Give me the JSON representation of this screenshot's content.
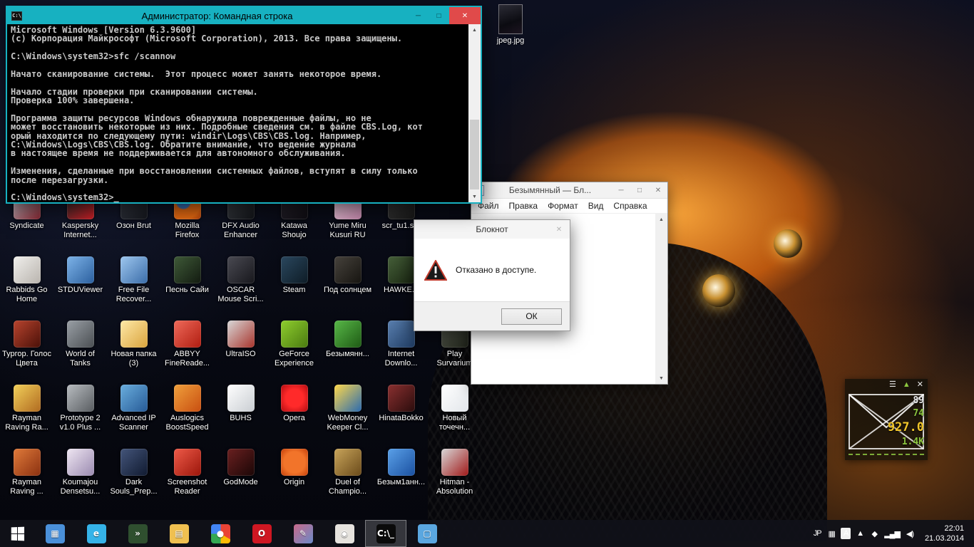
{
  "ui": {
    "scroll_up": "▲",
    "scroll_down": "▼",
    "min_glyph": "─",
    "max_glyph": "□",
    "close_glyph": "✕"
  },
  "cmd_window": {
    "accent": "#17b1c1",
    "icon_text": "C:\\",
    "title": "Администратор: Командная строка",
    "lines": [
      "Microsoft Windows [Version 6.3.9600]",
      "(c) Корпорация Майкрософт (Microsoft Corporation), 2013. Все права защищены.",
      "",
      "C:\\Windows\\system32>sfc /scannow",
      "",
      "Начато сканирование системы.  Этот процесс может занять некоторое время.",
      "",
      "Начало стадии проверки при сканировании системы.",
      "Проверка 100% завершена.",
      "",
      "Программа защиты ресурсов Windows обнаружила поврежденные файлы, но не",
      "может восстановить некоторые из них. Подробные сведения см. в файле CBS.Log, кот",
      "орый находится по следующему пути: windir\\Logs\\CBS\\CBS.log. Например,",
      "C:\\Windows\\Logs\\CBS\\CBS.log. Обратите внимание, что ведение журнала",
      "в настоящее время не поддерживается для автономного обслуживания.",
      "",
      "Изменения, сделанные при восстановлении системных файлов, вступят в силу только",
      "после перезагрузки.",
      "",
      "C:\\Windows\\system32>_"
    ]
  },
  "notepad": {
    "title": "Безымянный — Бл...",
    "menu": [
      {
        "label": "Файл"
      },
      {
        "label": "Правка"
      },
      {
        "label": "Формат"
      },
      {
        "label": "Вид"
      },
      {
        "label": "Справка"
      }
    ]
  },
  "dialog": {
    "title": "Блокнот",
    "message": "Отказано в доступе.",
    "ok": "ОК"
  },
  "desktop": {
    "jpeg_label": "jpeg.jpg",
    "row1": [
      {
        "label": "Syndicate",
        "color": "linear-gradient(135deg,#caced6,#8a2430)"
      },
      {
        "label": "Kaspersky Internet...",
        "color": "linear-gradient(135deg,#2b2b2b,#d21f26)"
      },
      {
        "label": "Озон Brut",
        "color": "linear-gradient(135deg,#3a3f4a,#14161c)"
      },
      {
        "label": "Mozilla Firefox",
        "color": "radial-gradient(circle at 35% 35%,#3b6fb5 0 26%,#e66a12 32% 70%,#b33c06 100%)"
      },
      {
        "label": "DFX Audio Enhancer",
        "color": "linear-gradient(135deg,#44484e,#101216)"
      },
      {
        "label": "Katawa Shoujo",
        "color": "linear-gradient(135deg,#2a2630,#0e0c12)"
      },
      {
        "label": "Yume Miru Kusuri RU",
        "color": "linear-gradient(135deg,#f3d7e6,#c687ad)"
      },
      {
        "label": "scr_tu1.s...",
        "color": "linear-gradient(135deg,#3c3c3c,#181818)"
      }
    ],
    "row2": [
      {
        "label": "Rabbids Go Home",
        "color": "linear-gradient(135deg,#f0efec,#b9b4ae)"
      },
      {
        "label": "STDUViewer",
        "color": "linear-gradient(135deg,#7db3e8,#2b5f9e)"
      },
      {
        "label": "Free File Recover...",
        "color": "linear-gradient(135deg,#9ec7ef,#3a6ca8)"
      },
      {
        "label": "Песнь Сайи",
        "color": "linear-gradient(135deg,#3f5a38,#121a10)"
      },
      {
        "label": "OSCAR Mouse Scri...",
        "color": "linear-gradient(135deg,#4a4a52,#17171c)"
      },
      {
        "label": "Steam",
        "color": "linear-gradient(135deg,#2a475e,#0e1c26)"
      },
      {
        "label": "Под солнцем",
        "color": "linear-gradient(135deg,#46423c,#161410)"
      },
      {
        "label": "HAWKE...",
        "color": "linear-gradient(135deg,#46603a,#182410)"
      }
    ],
    "row3": [
      {
        "label": "Тургор. Голос Цвета",
        "color": "linear-gradient(135deg,#b8442e,#4a1008)"
      },
      {
        "label": "World of Tanks",
        "color": "linear-gradient(135deg,#9aa0a6,#4a4e52)"
      },
      {
        "label": "Новая папка (3)",
        "color": "linear-gradient(135deg,#ffe9a8,#d9a33c)"
      },
      {
        "label": "ABBYY FineReade...",
        "color": "linear-gradient(135deg,#ef6a5a,#b01c10)"
      },
      {
        "label": "UltraISO",
        "color": "linear-gradient(135deg,#d8d8d8,#a8342c)"
      },
      {
        "label": "GeForce Experience",
        "color": "linear-gradient(135deg,#8fce2e,#4a7a10)"
      },
      {
        "label": "Безымянн...",
        "color": "linear-gradient(135deg,#58b848,#1e5a14)"
      },
      {
        "label": "Internet Downlo...",
        "color": "linear-gradient(135deg,#5a80b0,#1e3a60)"
      },
      {
        "label": "Play Survarium",
        "color": "linear-gradient(135deg,#5a5e52,#20241a)"
      }
    ],
    "row4": [
      {
        "label": "Rayman Raving Ra...",
        "color": "linear-gradient(135deg,#f2d05a,#b06a20)"
      },
      {
        "label": "Prototype 2 v1.0 Plus ...",
        "color": "linear-gradient(135deg,#b8bcc0,#585c60)"
      },
      {
        "label": "Advanced IP Scanner",
        "color": "linear-gradient(135deg,#6aaede,#265a96)"
      },
      {
        "label": "Auslogics BoostSpeed",
        "color": "linear-gradient(135deg,#f0a03c,#c84e10)"
      },
      {
        "label": "BUHS",
        "color": "linear-gradient(135deg,#ffffff,#c9cdd2)"
      },
      {
        "label": "Opera",
        "color": "radial-gradient(circle,#ff2a2a 0 45%,#b00b10 100%)"
      },
      {
        "label": "WebMoney Keeper Cl...",
        "color": "linear-gradient(135deg,#ffd84a,#2a6ab0)"
      },
      {
        "label": "HinataBokko",
        "color": "linear-gradient(135deg,#8a3030,#2a0c0c)"
      },
      {
        "label": "Новый точечн...",
        "color": "linear-gradient(135deg,#ffffff,#e2e6ea)"
      }
    ],
    "row5": [
      {
        "label": "Rayman Raving ...",
        "color": "linear-gradient(135deg,#e07a3a,#8a3010)"
      },
      {
        "label": "Koumajou Densetsu...",
        "color": "linear-gradient(135deg,#efe6f2,#9a8ab0)"
      },
      {
        "label": "Dark Souls_Prep...",
        "color": "linear-gradient(135deg,#44557a,#101a30)"
      },
      {
        "label": "Screenshot Reader",
        "color": "linear-gradient(135deg,#ef5a48,#9a150a)"
      },
      {
        "label": "GodMode",
        "color": "linear-gradient(135deg,#6a2020,#1a0606)"
      },
      {
        "label": "Origin",
        "color": "radial-gradient(circle,#f2742a 0 55%,#c23d08 100%)"
      },
      {
        "label": "Duel of Champio...",
        "color": "linear-gradient(135deg,#c8a45a,#6a4a1a)"
      },
      {
        "label": "Безым1анн...",
        "color": "linear-gradient(135deg,#5aa0e8,#1a50a0)"
      },
      {
        "label": "Hitman - Absolution",
        "color": "linear-gradient(135deg,#d8d8d8,#a01818)"
      }
    ]
  },
  "gadget": {
    "toolbar": [
      {
        "glyph": "☰",
        "color": "#e8e8e8"
      },
      {
        "glyph": "▲",
        "color": "#8cc63f"
      },
      {
        "glyph": "✕",
        "color": "#e8e8e8"
      }
    ],
    "values": [
      {
        "text": "89",
        "color": "#e8e8e8"
      },
      {
        "text": "74",
        "color": "#8cc63f"
      },
      {
        "text": "927.0",
        "color": "#f0c52a",
        "big": true
      },
      {
        "text": "1.4K",
        "color": "#8cc63f"
      }
    ]
  },
  "taskbar": {
    "icons": [
      {
        "glyph": "▦",
        "color": "#4a90d9"
      },
      {
        "glyph": "e",
        "color": "#35b3e8"
      },
      {
        "glyph": "»",
        "color": "#2f4f2f"
      },
      {
        "glyph": "▤",
        "color": "#f0c050"
      },
      {
        "glyph": "●",
        "color": "conic-gradient(#ea4335 0 120deg,#fbbc05 120deg 180deg,#34a853 180deg 270deg,#4285f4 270deg 360deg)"
      },
      {
        "glyph": "O",
        "color": "#cf1722"
      },
      {
        "glyph": "✎",
        "color": "linear-gradient(135deg,#c86a8a,#6a8ac8)"
      },
      {
        "glyph": "◉",
        "color": "#e6e3de"
      },
      {
        "glyph": "C:\\_",
        "color": "#0a0a0a",
        "active": true
      },
      {
        "glyph": "▢",
        "color": "#5aa7e0"
      }
    ],
    "tray": [
      {
        "glyph": "JP",
        "color": "transparent",
        "glyphColor": "#ffffff"
      },
      {
        "glyph": "▦",
        "color": "transparent",
        "glyphColor": "#9ab4e8"
      },
      {
        "glyph": "А",
        "color": "#f0f0f0",
        "glyphColor": "#222222"
      },
      {
        "glyph": "▲",
        "color": "transparent",
        "glyphColor": "#ffffff"
      },
      {
        "glyph": "◆",
        "color": "transparent",
        "glyphColor": "#d03a2a"
      },
      {
        "glyph": "▂▄▆",
        "color": "transparent",
        "glyphColor": "#ffffff"
      },
      {
        "glyph": "◀)",
        "color": "transparent",
        "glyphColor": "#ffffff"
      }
    ],
    "clock": {
      "time": "22:01",
      "date": "21.03.2014"
    }
  }
}
